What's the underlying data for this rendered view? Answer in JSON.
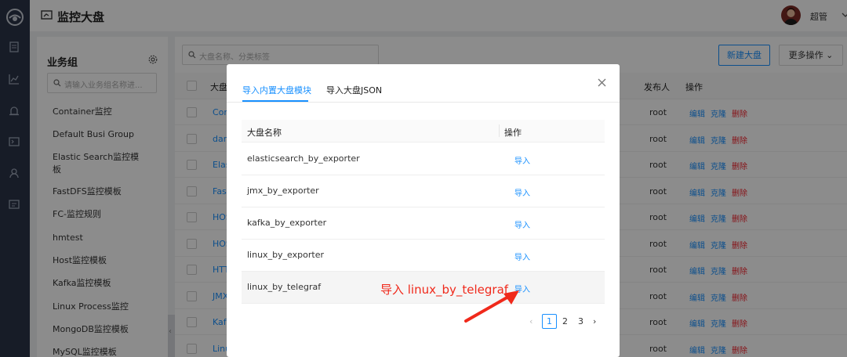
{
  "app": {
    "title": "监控大盘",
    "user": "超管"
  },
  "nav": {
    "icons": [
      "logo-icon",
      "dashboard-list-icon",
      "chart-icon",
      "alert-icon",
      "terminal-icon",
      "user-icon",
      "message-icon"
    ]
  },
  "groups": {
    "title": "业务组",
    "search_placeholder": "请输入业务组名称进...",
    "items": [
      "Container监控",
      "Default Busi Group",
      "Elastic Search监控模板",
      "FastDFS监控模板",
      "FC-监控规则",
      "hmtest",
      "Host监控模板",
      "Kafka监控模板",
      "Linux Process监控",
      "MongoDB监控模板",
      "MySQL监控模板"
    ]
  },
  "main": {
    "search_placeholder": "大盘名称、分类标签",
    "new_button": "新建大盘",
    "more_button": "更多操作",
    "columns": {
      "name": "大盘",
      "publisher": "发布人",
      "actions": "操作"
    },
    "rows": [
      {
        "name": "Con",
        "publisher": "root"
      },
      {
        "name": "dar",
        "publisher": "root"
      },
      {
        "name": "Elas",
        "publisher": "root"
      },
      {
        "name": "Fas",
        "publisher": "root"
      },
      {
        "name": "HOS",
        "publisher": "root"
      },
      {
        "name": "HOS",
        "publisher": "root"
      },
      {
        "name": "HTT",
        "publisher": "root"
      },
      {
        "name": "JMX",
        "publisher": "root"
      },
      {
        "name": "Kaf",
        "publisher": "root"
      },
      {
        "name": "Linu",
        "publisher": "root"
      }
    ],
    "row_actions": {
      "edit": "编辑",
      "clone": "克隆",
      "delete": "删除"
    }
  },
  "modal": {
    "tabs": [
      "导入内置大盘模块",
      "导入大盘JSON"
    ],
    "active_tab": 0,
    "table_headers": {
      "name": "大盘名称",
      "action": "操作"
    },
    "rows": [
      {
        "name": "elasticsearch_by_exporter",
        "action": "导入"
      },
      {
        "name": "jmx_by_exporter",
        "action": "导入"
      },
      {
        "name": "kafka_by_exporter",
        "action": "导入"
      },
      {
        "name": "linux_by_exporter",
        "action": "导入"
      },
      {
        "name": "linux_by_telegraf",
        "action": "导入"
      }
    ],
    "pagination": {
      "current": "1",
      "pages": [
        "1",
        "2",
        "3"
      ]
    }
  },
  "annotation": {
    "text": "导入 linux_by_telegraf",
    "color": "#f0291b"
  },
  "colors": {
    "primary": "#1890ff",
    "danger": "#f5222d",
    "rail": "#2b3447"
  }
}
